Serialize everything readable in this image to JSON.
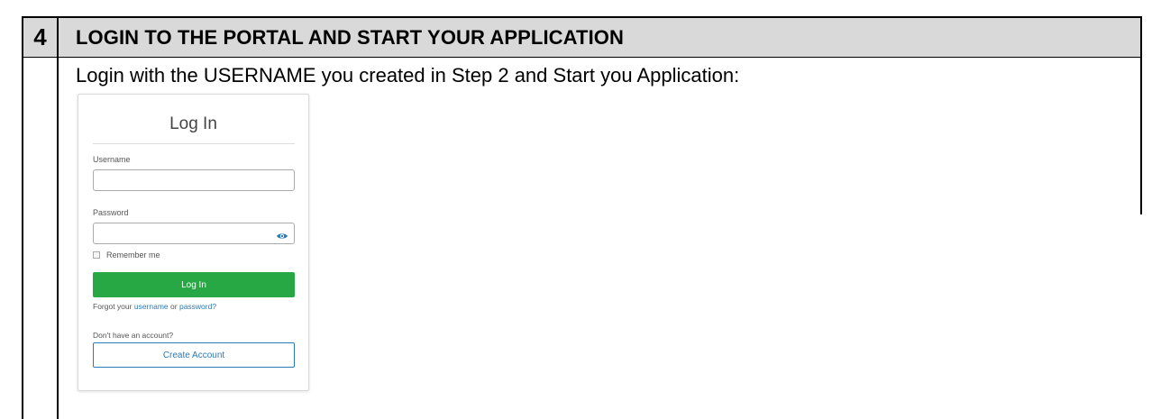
{
  "step": {
    "number": "4",
    "title": "LOGIN TO THE PORTAL AND START YOUR APPLICATION",
    "instruction": "Login with the USERNAME you created in Step 2 and Start you Application:"
  },
  "login": {
    "title": "Log In",
    "username_label": "Username",
    "username_value": "",
    "password_label": "Password",
    "password_value": "",
    "show_password_icon": "eye-icon",
    "remember_label": "Remember me",
    "login_button": "Log In",
    "forgot_prefix": "Forgot your",
    "forgot_username_link": "username",
    "forgot_or": "or",
    "forgot_password_link": "password?",
    "no_account_text": "Don't have an account?",
    "create_account_button": "Create Account"
  },
  "colors": {
    "header_bg": "#d9d9d9",
    "login_button": "#28a745",
    "link": "#2a7ab8"
  }
}
